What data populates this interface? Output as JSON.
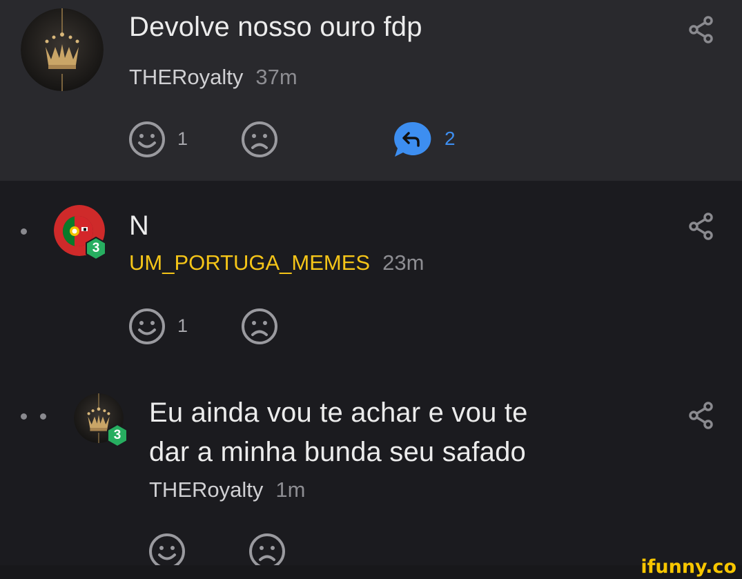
{
  "comments": [
    {
      "text": "Devolve nosso ouro fdp",
      "username": "THERoyalty",
      "time": "37m",
      "smile_count": "1",
      "reply_count": "2"
    },
    {
      "text": "N",
      "username": "UM_PORTUGA_MEMES",
      "time": "23m",
      "smile_count": "1",
      "badge_level": "3"
    },
    {
      "text_line1": "Eu ainda vou te achar e vou te",
      "text_line2": "dar a minha bunda seu safado",
      "username": "THERoyalty",
      "time": "1m",
      "badge_level": "3"
    }
  ],
  "watermark": "ifunny.co",
  "icons": [
    "share-icon",
    "smile-icon",
    "frown-icon",
    "reply-icon",
    "crown-avatar",
    "portugal-ball-avatar",
    "level-badge-icon"
  ],
  "colors": {
    "background": "#1b1b1f",
    "top_card": "#29292d",
    "username_yellow": "#f5c518",
    "reply_blue": "#3d8ef0",
    "badge_green": "#27ae60",
    "watermark": "#f7c600"
  }
}
